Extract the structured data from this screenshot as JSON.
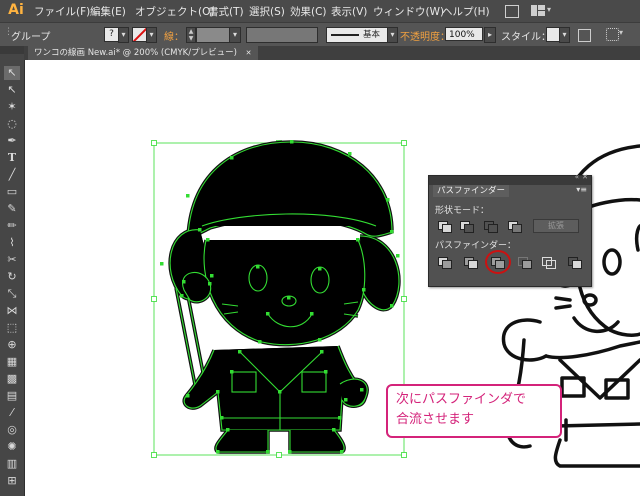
{
  "app": {
    "logo": "Ai"
  },
  "menu": [
    "ファイル(F)",
    "編集(E)",
    "オブジェクト(O)",
    "書式(T)",
    "選択(S)",
    "効果(C)",
    "表示(V)",
    "ウィンドウ(W)",
    "ヘルプ(H)"
  ],
  "control": {
    "selection_label": "グループ",
    "stroke_label": "線：",
    "stroke_style": "基本",
    "opacity_label": "不透明度：",
    "opacity_value": "100%",
    "style_label": "スタイル："
  },
  "document_tab": {
    "label": "ワンコの線画 New.ai* @ 200% (CMYK/プレビュー)",
    "close": "✕"
  },
  "pathfinder": {
    "tab_label": "パスファインダー",
    "shape_modes_label": "形状モード：",
    "expand_label": "拡張",
    "pathfinders_label": "パスファインダー："
  },
  "callout": {
    "line1": "次にパスファインダで",
    "line2": "合流させます"
  },
  "colors": {
    "accent_pink": "#d4237a",
    "selection_green": "#33dd33",
    "highlight_red": "#cc1111"
  }
}
